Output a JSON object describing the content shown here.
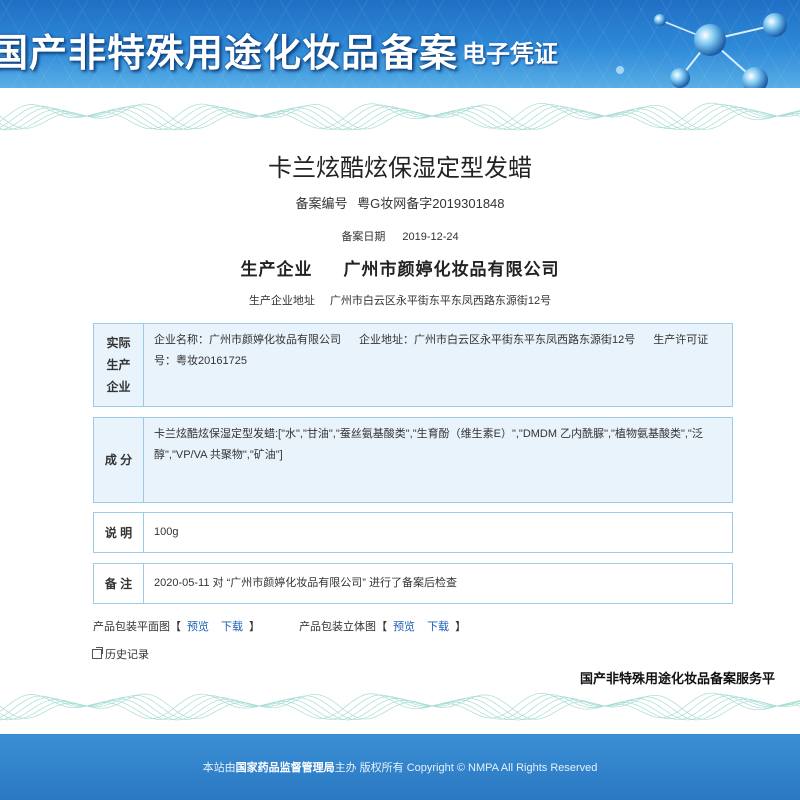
{
  "banner": {
    "title": "国产非特殊用途化妆品备案",
    "subtitle": "电子凭证"
  },
  "product": {
    "name": "卡兰炫酷炫保湿定型发蜡",
    "registration_label": "备案编号",
    "registration_number": "粤G妆网备字2019301848",
    "date_label": "备案日期",
    "date": "2019-12-24",
    "company_label": "生产企业",
    "company_name": "广州市颜婷化妆品有限公司",
    "address_label": "生产企业地址",
    "address": "广州市白云区永平街东平东凤西路东源街12号"
  },
  "actual_producer": {
    "heading_lines": [
      "实际",
      "生产",
      "企业"
    ],
    "name_seg": "企业名称：广州市颜婷化妆品有限公司",
    "address_seg": "企业地址：广州市白云区永平街东平东凤西路东源街12号",
    "license_seg": "生产许可证号：粤妆20161725"
  },
  "ingredients": {
    "heading": "成 分",
    "text": "卡兰炫酷炫保湿定型发蜡:[\"水\",\"甘油\",\"蚕丝氨基酸类\",\"生育酚（维生素E）\",\"DMDM 乙内酰脲\",\"植物氨基酸类\",\"泛醇\",\"VP/VA 共聚物\",\"矿油\"]"
  },
  "description": {
    "heading": "说 明",
    "text": "100g"
  },
  "notes": {
    "heading": "备 注",
    "text": "2020-05-11 对 “广州市颜婷化妆品有限公司” 进行了备案后检查"
  },
  "package": {
    "flat_label": "产品包装平面图",
    "flat_preview": "预览",
    "flat_download": "下载",
    "solid_label": "产品包装立体图",
    "solid_preview": "预览",
    "solid_download": "下载",
    "bracket_open": "【",
    "bracket_close": "】"
  },
  "history": {
    "label": "历史记录",
    "icon": "external-window-icon"
  },
  "service_label": "国产非特殊用途化妆品备案服务平",
  "footer": {
    "prefix": "本站由",
    "org": "国家药品监督管理局",
    "suffix": "主办 版权所有 Copyright © NMPA All Rights Reserved"
  },
  "colors": {
    "banner": "#2f8ad8",
    "row_bg": "#e9f3fb",
    "row_border": "#9ccbea",
    "link": "#1a5fb4",
    "footer": "#2f83cb"
  }
}
